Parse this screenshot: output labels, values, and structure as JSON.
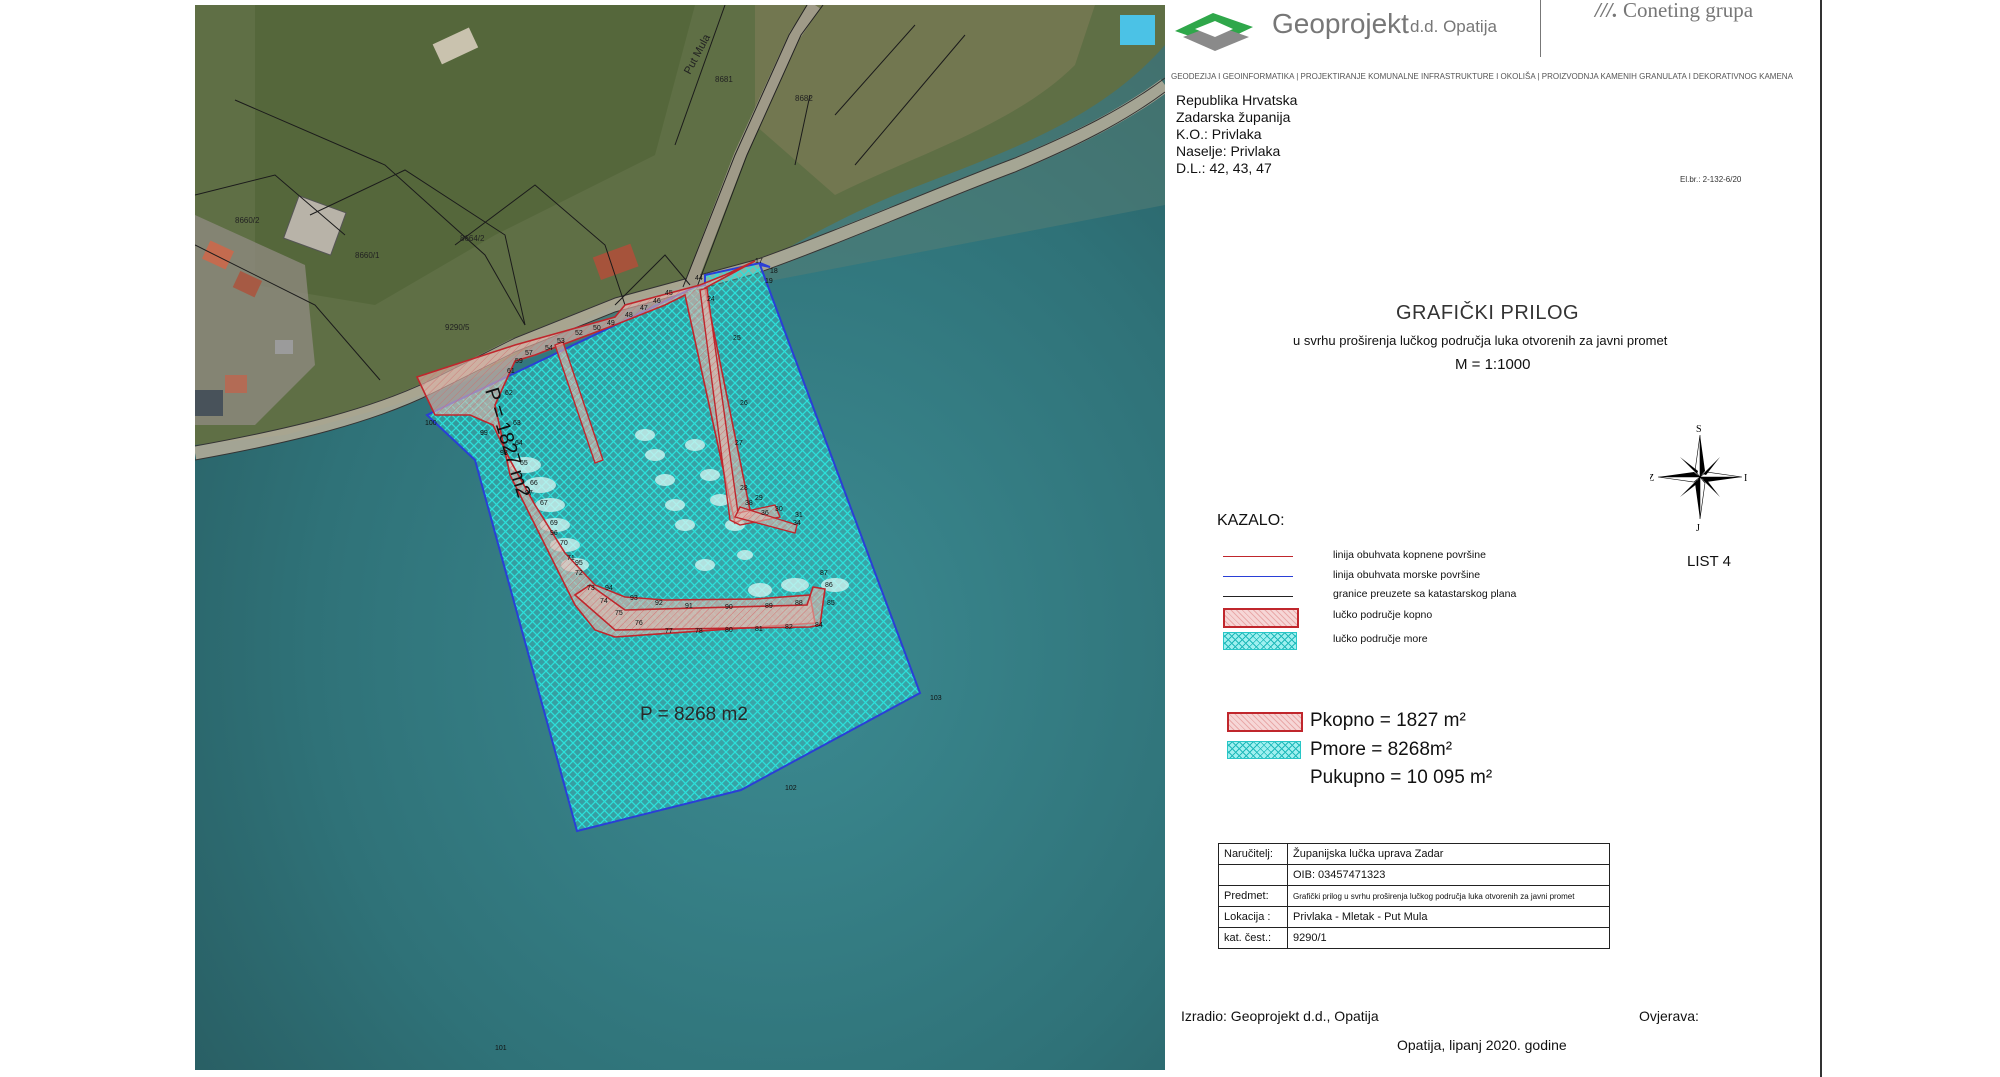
{
  "header": {
    "brand": "Geoprojekt",
    "brand_sub": "d.d. Opatija",
    "partner": "Coneting grupa",
    "taglines": [
      "GEODEZIJA I GEOINFORMATIKA",
      "PROJEKTIRANJE KOMUNALNE INFRASTRUKTURE I OKOLIŠA",
      "PROIZVODNJA KAMENIH GRANULATA I DEKORATIVNOG KAMENA"
    ]
  },
  "location": {
    "lines": [
      "Republika Hrvatska",
      "Zadarska županija",
      "K.O.: Privlaka",
      "Naselje: Privlaka",
      "D.L.: 42, 43, 47"
    ],
    "el_br": "El.br.: 2-132-6/20"
  },
  "title": {
    "main": "GRAFIČKI PRILOG",
    "subtitle": "u svrhu proširenja lučkog područja luka otvorenih za javni promet",
    "scale": "M = 1:1000"
  },
  "compass": {
    "n": "S",
    "s": "J",
    "w": "Z",
    "e": "I"
  },
  "sheet": "LIST 4",
  "legend": {
    "title": "KAZALO:",
    "items": [
      {
        "type": "line",
        "color": "#c0262c",
        "label": "linija obuhvata kopnene površine"
      },
      {
        "type": "line",
        "color": "#2a3fd6",
        "label": "linija obuhvata morske površine"
      },
      {
        "type": "line",
        "color": "#222222",
        "label": "granice preuzete sa katastarskog plana"
      },
      {
        "type": "red-hatch",
        "label": "lučko područje kopno"
      },
      {
        "type": "cyan-hatch",
        "label": "lučko područje more"
      }
    ]
  },
  "areas": {
    "land_label": "Pkopno = 1827 m²",
    "sea_label": "Pmore = 8268m²",
    "total_label": "Pukupno = 10 095 m²"
  },
  "info_table": [
    {
      "key": "Naručitelj:",
      "value": "Županijska lučka uprava Zadar"
    },
    {
      "key": "",
      "value": "OIB: 03457471323"
    },
    {
      "key": "Predmet:",
      "value": "Grafički prilog u svrhu proširenja lučkog područja luka otvorenih za javni promet"
    },
    {
      "key": "Lokacija :",
      "value": "Privlaka - Mletak - Put Mula"
    },
    {
      "key": "kat. čest.:",
      "value": "9290/1"
    }
  ],
  "footer": {
    "made_by": "Izradio: Geoprojekt d.d., Opatija",
    "verified": "Ovjerava:",
    "place_date": "Opatija, lipanj 2020. godine"
  },
  "map": {
    "land_area_label": "P = 1827 m2",
    "sea_area_label": "P = 8268 m2",
    "road_label": "Put Mula",
    "parcels": [
      "8681",
      "8682",
      "8660/2",
      "8660/1",
      "8664/2",
      "9290/5"
    ],
    "point_labels": [
      "100",
      "101",
      "102",
      "103",
      "17",
      "18",
      "19",
      "24",
      "25",
      "26",
      "27",
      "28",
      "29",
      "30",
      "31",
      "34",
      "36",
      "38",
      "44",
      "45",
      "46",
      "47",
      "48",
      "49",
      "50",
      "52",
      "53",
      "54",
      "57",
      "59",
      "61",
      "62",
      "63",
      "64",
      "65",
      "66",
      "67",
      "69",
      "70",
      "71",
      "72",
      "73",
      "74",
      "75",
      "76",
      "77",
      "78",
      "80",
      "81",
      "82",
      "84",
      "85",
      "86",
      "87",
      "88",
      "89",
      "90",
      "91",
      "92",
      "93",
      "94",
      "95",
      "96",
      "97",
      "98",
      "99"
    ],
    "colors": {
      "land_line": "#c0262c",
      "sea_line": "#2a3fd6",
      "sea_fill": "#35d6d6",
      "water": "#3a7f86"
    }
  }
}
